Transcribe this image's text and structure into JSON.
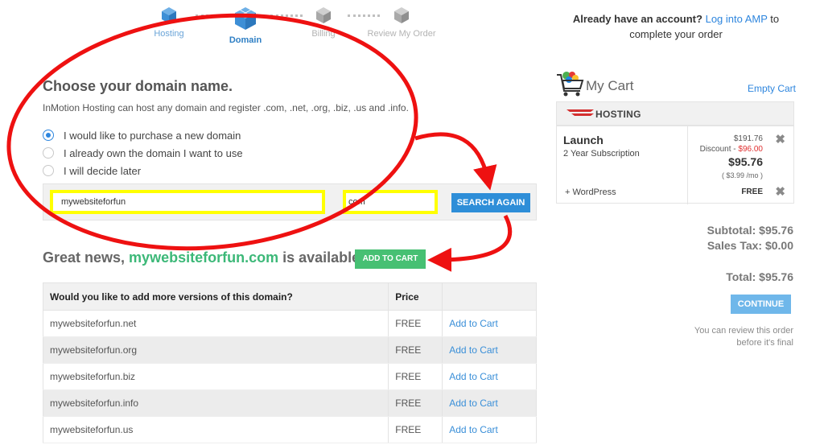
{
  "steps": [
    {
      "label": "Hosting",
      "state": "done"
    },
    {
      "label": "Domain",
      "state": "active"
    },
    {
      "label": "Billing",
      "state": "future"
    },
    {
      "label": "Review My Order",
      "state": "future"
    }
  ],
  "main": {
    "title": "Choose your domain name.",
    "description": "InMotion Hosting can host any domain and register .com, .net, .org, .biz, .us and .info.",
    "options": [
      {
        "label": "I would like to purchase a new domain",
        "checked": true
      },
      {
        "label": "I already own the domain I want to use",
        "checked": false
      },
      {
        "label": "I will decide later",
        "checked": false
      }
    ],
    "search": {
      "domain_value": "mywebsiteforfun",
      "tld_value": "com",
      "button_label": "SEARCH AGAIN"
    },
    "result": {
      "prefix": "Great news, ",
      "domain": "mywebsiteforfun.com",
      "suffix": " is available!",
      "add_button": "ADD TO CART"
    },
    "table": {
      "headers": [
        "Would you like to add more versions of this domain?",
        "Price",
        ""
      ],
      "rows": [
        {
          "domain": "mywebsiteforfun.net",
          "price": "FREE",
          "action": "Add to Cart"
        },
        {
          "domain": "mywebsiteforfun.org",
          "price": "FREE",
          "action": "Add to Cart"
        },
        {
          "domain": "mywebsiteforfun.biz",
          "price": "FREE",
          "action": "Add to Cart"
        },
        {
          "domain": "mywebsiteforfun.info",
          "price": "FREE",
          "action": "Add to Cart"
        },
        {
          "domain": "mywebsiteforfun.us",
          "price": "FREE",
          "action": "Add to Cart"
        }
      ]
    }
  },
  "account": {
    "lead": "Already have an account?",
    "link": "Log into AMP",
    "tail_1": " to",
    "tail_2": "complete your order"
  },
  "cart": {
    "title": "My Cart",
    "empty_link": "Empty Cart",
    "section": "HOSTING",
    "item": {
      "name": "Launch",
      "subscription": "2 Year Subscription",
      "original_price": "$191.76",
      "discount_label": "Discount - ",
      "discount_value": "$96.00",
      "final_price": "$95.76",
      "per_month": "( $3.99 /mo )",
      "addon_name": "+ WordPress",
      "addon_price": "FREE",
      "remove_glyph": "✖"
    },
    "subtotal": "Subtotal: $95.76",
    "sales_tax": "Sales Tax: $0.00",
    "total": "Total: $95.76",
    "continue_button": "CONTINUE",
    "review_note_1": "You can review this order",
    "review_note_2": "before it's final"
  },
  "colors": {
    "accent_blue": "#2e8ed8",
    "success_green": "#47c073",
    "annotation_red": "#ee1111",
    "highlight_yellow": "#ffff00"
  },
  "icons": [
    "cube-step-icon",
    "shopping-cart-icon",
    "hosting-logo-icon",
    "remove-icon"
  ]
}
